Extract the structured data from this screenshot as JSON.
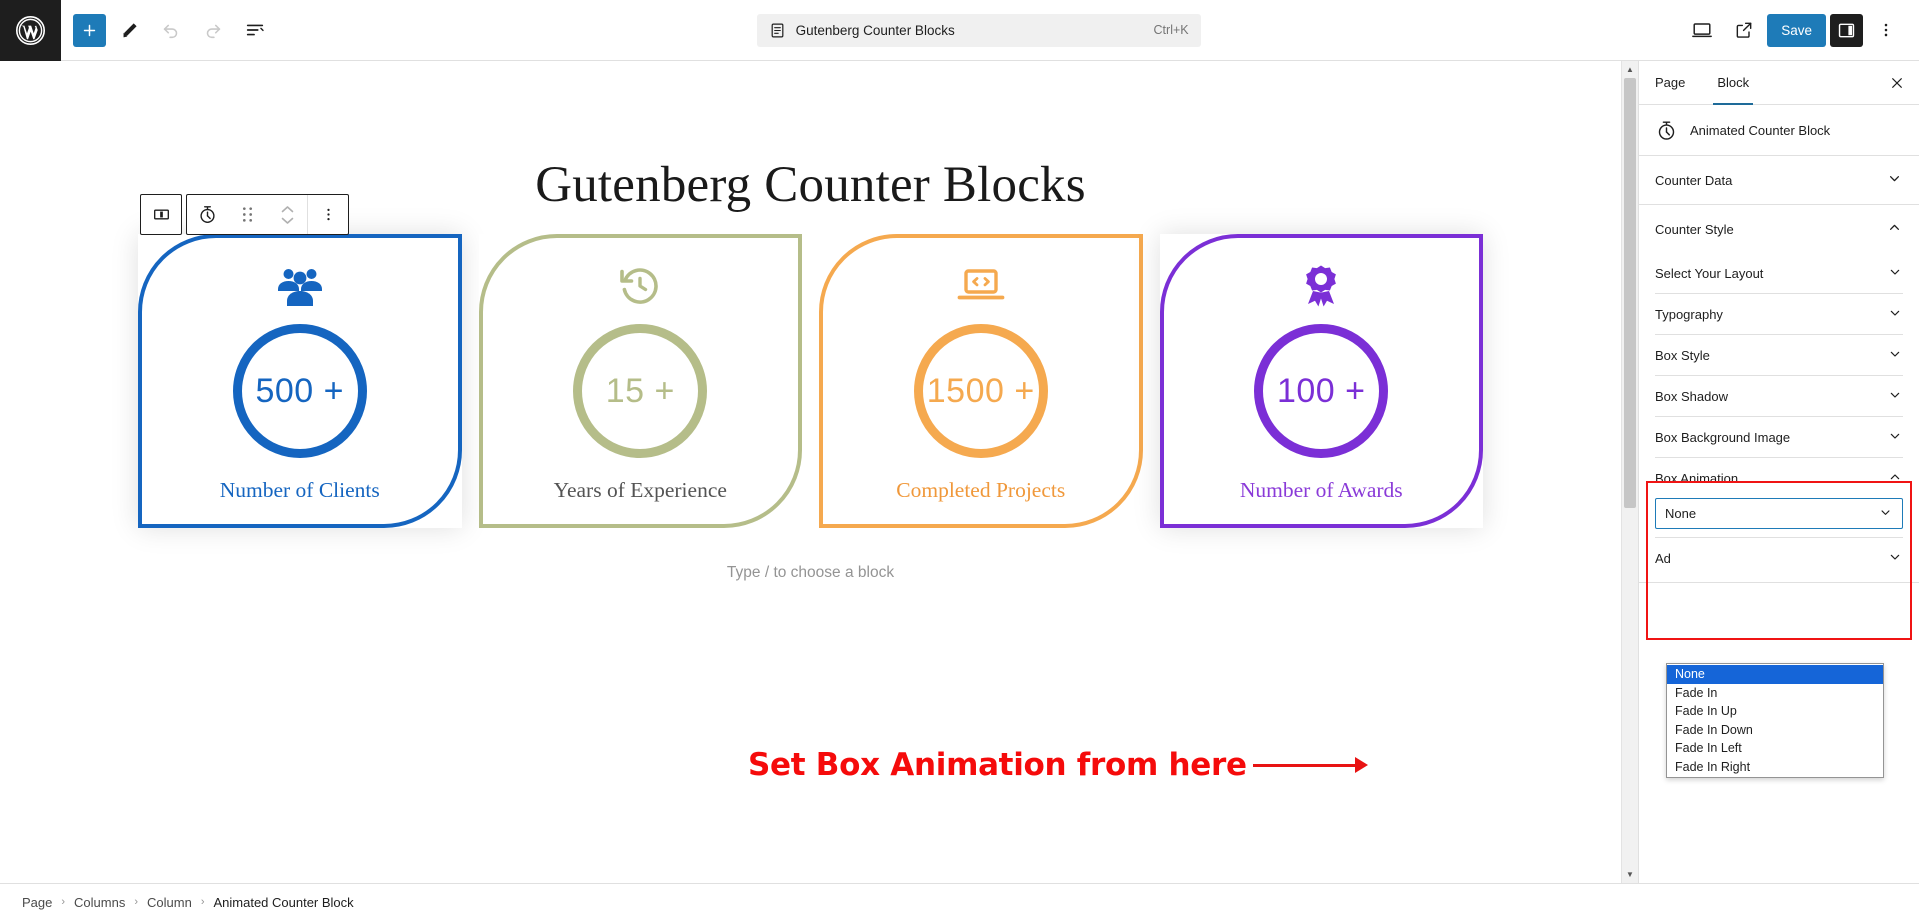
{
  "topbar": {
    "logo": "wordpress-logo",
    "add_block_label": "+",
    "tools": [
      "block-inserter",
      "edit-pencil",
      "undo",
      "redo",
      "list-view"
    ],
    "command_title": "Gutenberg Counter Blocks",
    "command_shortcut": "Ctrl+K",
    "save_label": "Save",
    "right_tools": [
      "desktop-preview",
      "view-external",
      "settings-sidebar",
      "options-menu"
    ]
  },
  "block_toolbar": {
    "items": [
      "columns-icon",
      "stopwatch-icon",
      "drag-handle-icon",
      "move-updown-icon",
      "more-options-icon"
    ]
  },
  "canvas": {
    "heading": "Gutenberg Counter Blocks",
    "type_hint": "Type / to choose a block",
    "cards": [
      {
        "icon": "people-group-icon",
        "number": "500 +",
        "label": "Number of Clients",
        "color": "#1565c0",
        "label_color": "#1565c0",
        "selected": true
      },
      {
        "icon": "history-clock-icon",
        "number": "15 +",
        "label": "Years of Experience",
        "color": "#b5bd89",
        "label_color": "#545454",
        "selected": false
      },
      {
        "icon": "laptop-code-icon",
        "number": "1500 +",
        "label": "Completed Projects",
        "color": "#f5a94f",
        "label_color": "#f0983a",
        "selected": false
      },
      {
        "icon": "award-ribbon-icon",
        "number": "100 +",
        "label": "Number of Awards",
        "color": "#7b2fd6",
        "label_color": "#8a3ad8",
        "selected": false
      }
    ]
  },
  "annotation": {
    "text": "Set Box Animation from here",
    "color": "#f01414"
  },
  "breadcrumb": {
    "items": [
      "Page",
      "Columns",
      "Column",
      "Animated Counter Block"
    ],
    "separator": "›"
  },
  "sidebar": {
    "tabs": [
      {
        "label": "Page",
        "active": false
      },
      {
        "label": "Block",
        "active": true
      }
    ],
    "close_label": "✕",
    "block_name": "Animated Counter Block",
    "block_icon": "stopwatch-icon",
    "panels": [
      {
        "label": "Counter Data",
        "expanded": false
      },
      {
        "label": "Counter Style",
        "expanded": true
      }
    ],
    "style_subpanels": [
      {
        "label": "Select Your Layout",
        "expanded": false
      },
      {
        "label": "Typography",
        "expanded": false
      },
      {
        "label": "Box Style",
        "expanded": false
      },
      {
        "label": "Box Shadow",
        "expanded": false
      },
      {
        "label": "Box Background Image",
        "expanded": false
      },
      {
        "label": "Box Animation",
        "expanded": true
      }
    ],
    "animation_select": {
      "value": "None",
      "options": [
        "None",
        "Fade In",
        "Fade In Up",
        "Fade In Down",
        "Fade In Left",
        "Fade In Right"
      ],
      "selected_index": 0
    },
    "obscured_panel_label": "Ad"
  },
  "colors": {
    "accent_blue": "#1e7bb8",
    "annotation_red": "#f01414",
    "dropdown_highlight": "#1565d8"
  }
}
